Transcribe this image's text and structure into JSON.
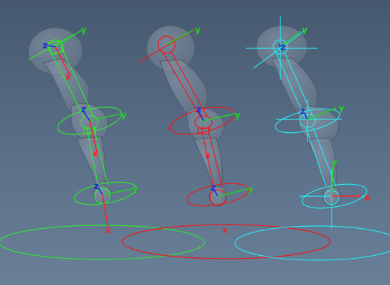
{
  "viewport": {
    "background_top": "#45586f",
    "background_bottom": "#6a7f98"
  },
  "colors": {
    "mesh_fill": "#8a98a8",
    "mesh_stroke": "#4d5c6d",
    "axis_x": "#ff1e1e",
    "axis_y": "#22d222",
    "axis_z": "#1428dc",
    "rig_green": "#2ee82e",
    "rig_red": "#f01818",
    "rig_cyan": "#28e6f0"
  },
  "rigs": [
    {
      "name": "green-rig",
      "labels": {
        "top_z": "z",
        "top_y": "y",
        "top_x": "x",
        "mid_z": "z",
        "mid_y": "y",
        "mid_x": "x",
        "low_z": "z",
        "low_y": "y",
        "bottom_x": "x"
      }
    },
    {
      "name": "red-rig",
      "labels": {
        "top_y": "y",
        "mid_z": "z",
        "mid_y": "y",
        "mid_x": "x",
        "low_z": "z",
        "low_y": "y",
        "bottom_x": "x"
      }
    },
    {
      "name": "cyan-rig",
      "labels": {
        "top_z": "z",
        "top_y": "y",
        "mid_z": "z",
        "mid_y": "y",
        "low_y": "y",
        "bottom_x": "x"
      }
    }
  ]
}
